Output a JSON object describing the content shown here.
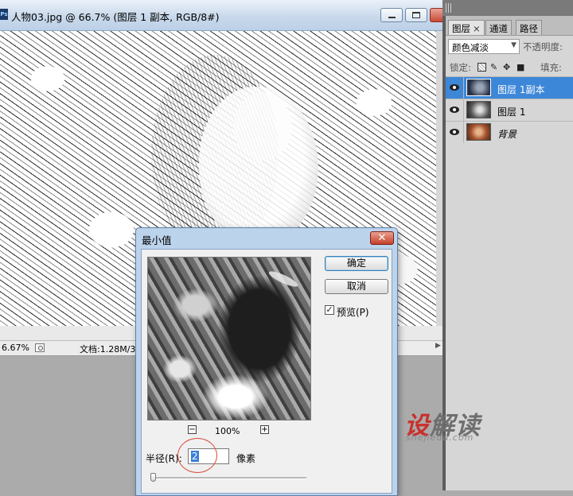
{
  "document": {
    "title": "人物03.jpg @ 66.7% (图层 1 副本, RGB/8#)",
    "zoom_readout": "6.67%",
    "doc_info": "文档:1.28M/3."
  },
  "panel": {
    "tabs": [
      {
        "label": "图层"
      },
      {
        "label": "通道"
      },
      {
        "label": "路径"
      }
    ],
    "tab_close": "×",
    "blend_mode": "颜色减淡",
    "opacity_label": "不透明度:",
    "lock_label": "锁定:",
    "fill_label": "填充:",
    "layers": [
      {
        "name": "图层 1副本",
        "selected": true
      },
      {
        "name": "图层 1",
        "selected": false
      },
      {
        "name": "背景",
        "selected": false
      }
    ]
  },
  "dialog": {
    "title": "最小值",
    "close_glyph": "✕",
    "ok_label": "确定",
    "cancel_label": "取消",
    "preview_checked": true,
    "preview_check_glyph": "✓",
    "preview_label": "预览(P)",
    "zoom_out": "−",
    "zoom_in": "+",
    "zoom_level": "100%",
    "radius_label": "半径(R):",
    "radius_value": "2",
    "radius_unit": "像素",
    "radius_slider_fraction": 0.0
  },
  "watermark": {
    "main_red": "设",
    "main_gray": "解读",
    "sub": "shejiedu.com"
  },
  "colors": {
    "selection": "#3d87d8",
    "accent_red": "#c9302c"
  }
}
